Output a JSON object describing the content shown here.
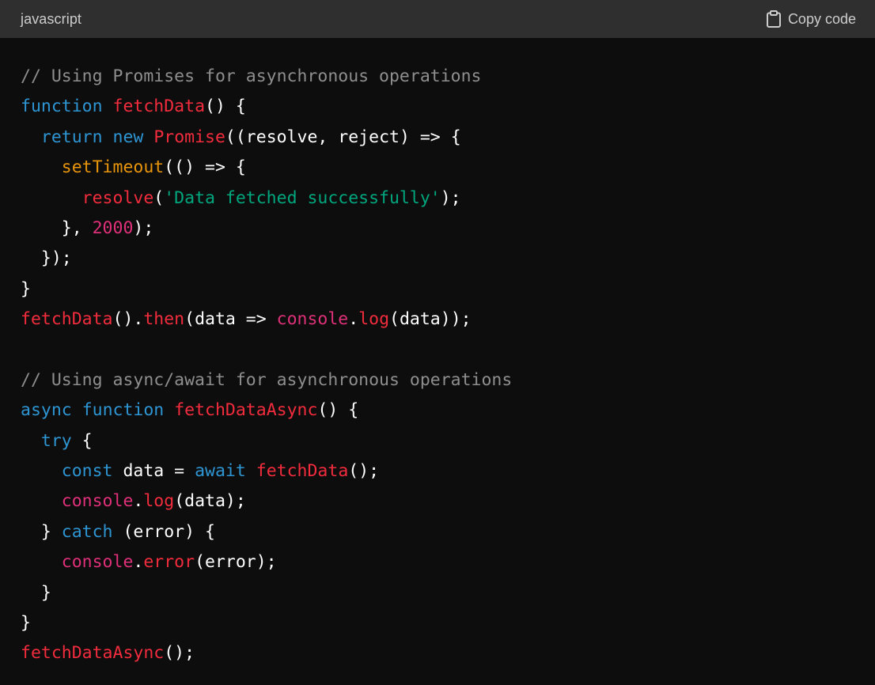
{
  "header": {
    "language": "javascript",
    "copy_label": "Copy code",
    "copy_icon": "clipboard-icon"
  },
  "colors": {
    "background": "#0d0d0d",
    "header_background": "#2f2f2f",
    "comment": "#8e8e8e",
    "keyword": "#2e95d3",
    "function": "#f22c3d",
    "builtin": "#e9950c",
    "string": "#00a67d",
    "number": "#df3079",
    "plain": "#ffffff"
  },
  "code": {
    "lines": [
      [
        {
          "t": "comment",
          "v": "// Using Promises for asynchronous operations"
        }
      ],
      [
        {
          "t": "keyword",
          "v": "function"
        },
        {
          "t": "plain",
          "v": " "
        },
        {
          "t": "func",
          "v": "fetchData"
        },
        {
          "t": "plain",
          "v": "() {"
        }
      ],
      [
        {
          "t": "plain",
          "v": "  "
        },
        {
          "t": "keyword",
          "v": "return"
        },
        {
          "t": "plain",
          "v": " "
        },
        {
          "t": "keyword",
          "v": "new"
        },
        {
          "t": "plain",
          "v": " "
        },
        {
          "t": "func",
          "v": "Promise"
        },
        {
          "t": "plain",
          "v": "((resolve, reject) => {"
        }
      ],
      [
        {
          "t": "plain",
          "v": "    "
        },
        {
          "t": "builtin",
          "v": "setTimeout"
        },
        {
          "t": "plain",
          "v": "(() => {"
        }
      ],
      [
        {
          "t": "plain",
          "v": "      "
        },
        {
          "t": "func",
          "v": "resolve"
        },
        {
          "t": "plain",
          "v": "("
        },
        {
          "t": "string",
          "v": "'Data fetched successfully'"
        },
        {
          "t": "plain",
          "v": ");"
        }
      ],
      [
        {
          "t": "plain",
          "v": "    }, "
        },
        {
          "t": "number",
          "v": "2000"
        },
        {
          "t": "plain",
          "v": ");"
        }
      ],
      [
        {
          "t": "plain",
          "v": "  });"
        }
      ],
      [
        {
          "t": "plain",
          "v": "}"
        }
      ],
      [
        {
          "t": "func",
          "v": "fetchData"
        },
        {
          "t": "plain",
          "v": "()."
        },
        {
          "t": "func",
          "v": "then"
        },
        {
          "t": "plain",
          "v": "(data => "
        },
        {
          "t": "object",
          "v": "console"
        },
        {
          "t": "plain",
          "v": "."
        },
        {
          "t": "func",
          "v": "log"
        },
        {
          "t": "plain",
          "v": "(data));"
        }
      ],
      [],
      [
        {
          "t": "comment",
          "v": "// Using async/await for asynchronous operations"
        }
      ],
      [
        {
          "t": "keyword",
          "v": "async"
        },
        {
          "t": "plain",
          "v": " "
        },
        {
          "t": "keyword",
          "v": "function"
        },
        {
          "t": "plain",
          "v": " "
        },
        {
          "t": "func",
          "v": "fetchDataAsync"
        },
        {
          "t": "plain",
          "v": "() {"
        }
      ],
      [
        {
          "t": "plain",
          "v": "  "
        },
        {
          "t": "keyword",
          "v": "try"
        },
        {
          "t": "plain",
          "v": " {"
        }
      ],
      [
        {
          "t": "plain",
          "v": "    "
        },
        {
          "t": "keyword",
          "v": "const"
        },
        {
          "t": "plain",
          "v": " data = "
        },
        {
          "t": "keyword",
          "v": "await"
        },
        {
          "t": "plain",
          "v": " "
        },
        {
          "t": "func",
          "v": "fetchData"
        },
        {
          "t": "plain",
          "v": "();"
        }
      ],
      [
        {
          "t": "plain",
          "v": "    "
        },
        {
          "t": "object",
          "v": "console"
        },
        {
          "t": "plain",
          "v": "."
        },
        {
          "t": "func",
          "v": "log"
        },
        {
          "t": "plain",
          "v": "(data);"
        }
      ],
      [
        {
          "t": "plain",
          "v": "  } "
        },
        {
          "t": "keyword",
          "v": "catch"
        },
        {
          "t": "plain",
          "v": " (error) {"
        }
      ],
      [
        {
          "t": "plain",
          "v": "    "
        },
        {
          "t": "object",
          "v": "console"
        },
        {
          "t": "plain",
          "v": "."
        },
        {
          "t": "func",
          "v": "error"
        },
        {
          "t": "plain",
          "v": "(error);"
        }
      ],
      [
        {
          "t": "plain",
          "v": "  }"
        }
      ],
      [
        {
          "t": "plain",
          "v": "}"
        }
      ],
      [
        {
          "t": "func",
          "v": "fetchDataAsync"
        },
        {
          "t": "plain",
          "v": "();"
        }
      ]
    ]
  }
}
